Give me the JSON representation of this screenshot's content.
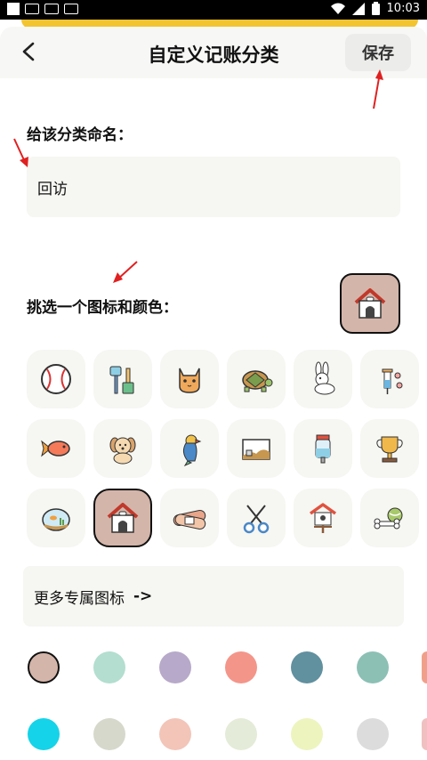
{
  "statusbar": {
    "time": "10:03"
  },
  "header": {
    "title": "自定义记账分类",
    "save_label": "保存"
  },
  "name_section": {
    "label": "给该分类命名：",
    "value": "回访"
  },
  "icon_section": {
    "label": "挑选一个图标和颜色："
  },
  "icons": [
    "baseball-icon",
    "cleaning-tools-icon",
    "cat-icon",
    "tortoise-icon",
    "rabbit-icon",
    "syringe-icon",
    "goldfish-icon",
    "puppy-icon",
    "parrot-icon",
    "aquarium-landscape-icon",
    "water-bottle-icon",
    "trophy-icon",
    "fish-tank-icon",
    "dog-house-icon",
    "bandage-icon",
    "scissors-icon",
    "bird-house-icon",
    "bone-ball-icon"
  ],
  "selected_icon": "dog-house-icon",
  "more_icons": {
    "label": "更多专属图标",
    "arrow": "->"
  },
  "colors": {
    "row1": [
      "#d4b5aa",
      "#b3ded0",
      "#b7a9c9",
      "#f4958a",
      "#61909f",
      "#8cc0b5",
      "#f0a08a"
    ],
    "row2": [
      "#15d3e8",
      "#d6d8cb",
      "#f2c5b8",
      "#e4ebd8",
      "#edf4be",
      "#dcdcdc",
      "#f0c0c0"
    ],
    "selected": "#d4b5aa",
    "accent_yellow": "#f2c431",
    "annotation_red": "#e02020"
  }
}
